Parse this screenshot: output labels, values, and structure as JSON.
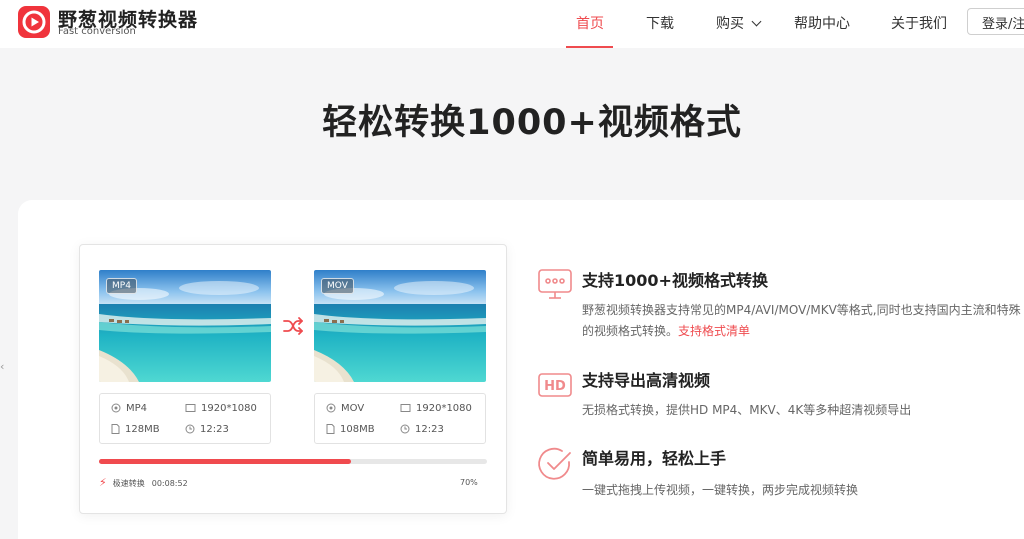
{
  "brand": {
    "name": "野葱视频转换器",
    "subtitle": "Fast conversion",
    "accent": "#ef4b4f"
  },
  "nav": {
    "items": [
      {
        "label": "首页",
        "active": true
      },
      {
        "label": "下载"
      },
      {
        "label": "购买",
        "has_dropdown": true
      },
      {
        "label": "帮助中心"
      },
      {
        "label": "关于我们"
      }
    ],
    "login_label": "登录/注册"
  },
  "hero": {
    "title": "轻松转换1000+视频格式"
  },
  "converter": {
    "source": {
      "tag": "MP4",
      "format": "MP4",
      "resolution": "1920*1080",
      "size": "128MB",
      "duration": "12:23"
    },
    "target": {
      "tag": "MOV",
      "format": "MOV",
      "resolution": "1920*1080",
      "size": "108MB",
      "duration": "12:23"
    },
    "progress_fraction": 0.65,
    "speed_label": "极速转换",
    "elapsed": "00:08:52",
    "percent_label": "70%"
  },
  "features": [
    {
      "icon": "monitor-icon",
      "title": "支持1000+视频格式转换",
      "desc": "野葱视频转换器支持常见的MP4/AVI/MOV/MKV等格式,同时也支持国内主流和特殊的视频格式转换。",
      "link": "支持格式清单"
    },
    {
      "icon": "hd-icon",
      "title": "支持导出高清视频",
      "desc": "无损格式转换，提供HD MP4、MKV、4K等多种超清视频导出"
    },
    {
      "icon": "check-circle-icon",
      "title": "简单易用，轻松上手",
      "desc": "一键式拖拽上传视频，一键转换，两步完成视频转换"
    }
  ]
}
